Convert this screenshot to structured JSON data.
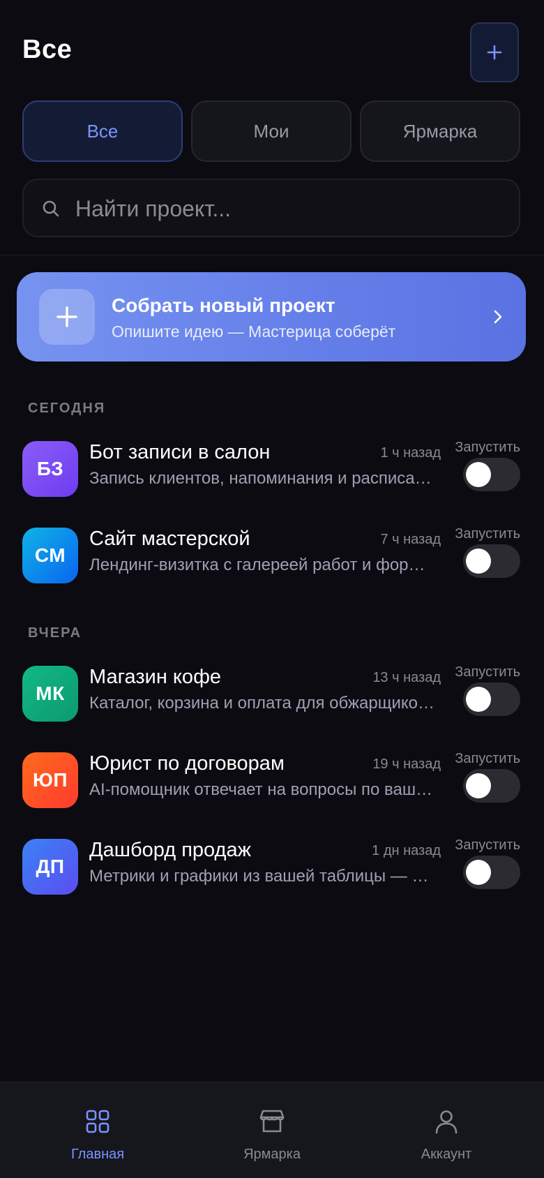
{
  "header": {
    "title": "Все",
    "add_icon": "plus-icon"
  },
  "tabs": [
    {
      "label": "Все",
      "active": true
    },
    {
      "label": "Мои",
      "active": false
    },
    {
      "label": "Ярмарка",
      "active": false
    }
  ],
  "search": {
    "placeholder": "Найти проект...",
    "value": "",
    "icon": "search-icon"
  },
  "promo": {
    "title": "Собрать новый проект",
    "subtitle": "Опишите идею — Мастерица соберёт",
    "icon": "plus-icon",
    "chevron": "chevron-right-icon"
  },
  "sections": [
    {
      "label": "СЕГОДНЯ",
      "projects": [
        {
          "initials": "БЗ",
          "title": "Бот записи в салон",
          "time": "1 ч назад",
          "description": "Запись клиентов, напоминания и расписание мастеров",
          "run_label": "Запустить",
          "enabled": false,
          "color_from": "#8b5cf6",
          "color_to": "#6d3df2"
        },
        {
          "initials": "СМ",
          "title": "Сайт мастерской",
          "time": "7 ч назад",
          "description": "Лендинг-визитка с галереей работ и формой заявки",
          "run_label": "Запустить",
          "enabled": false,
          "color_from": "#0fb4e6",
          "color_to": "#0a64f0"
        }
      ]
    },
    {
      "label": "ВЧЕРА",
      "projects": [
        {
          "initials": "МК",
          "title": "Магазин кофе",
          "time": "13 ч назад",
          "description": "Каталог, корзина и оплата для обжарщиков кофе",
          "run_label": "Запустить",
          "enabled": false,
          "color_from": "#12b886",
          "color_to": "#0c9a70"
        },
        {
          "initials": "ЮП",
          "title": "Юрист по договорам",
          "time": "19 ч назад",
          "description": "AI-помощник отвечает на вопросы по вашим договорам",
          "run_label": "Запустить",
          "enabled": false,
          "color_from": "#ff6a1a",
          "color_to": "#ff3b30"
        },
        {
          "initials": "ДП",
          "title": "Дашборд продаж",
          "time": "1 дн назад",
          "description": "Метрики и графики из вашей таблицы — автоматически",
          "run_label": "Запустить",
          "enabled": false,
          "color_from": "#3b82f6",
          "color_to": "#5b4df0"
        }
      ]
    }
  ],
  "bottom_nav": [
    {
      "label": "Главная",
      "icon": "grid-icon",
      "active": true
    },
    {
      "label": "Ярмарка",
      "icon": "store-icon",
      "active": false
    },
    {
      "label": "Аккаунт",
      "icon": "user-icon",
      "active": false
    }
  ],
  "colors": {
    "background": "#0b0b11",
    "accent": "#7a95ff",
    "promo_from": "#7693f0",
    "promo_to": "#5a72e2"
  }
}
